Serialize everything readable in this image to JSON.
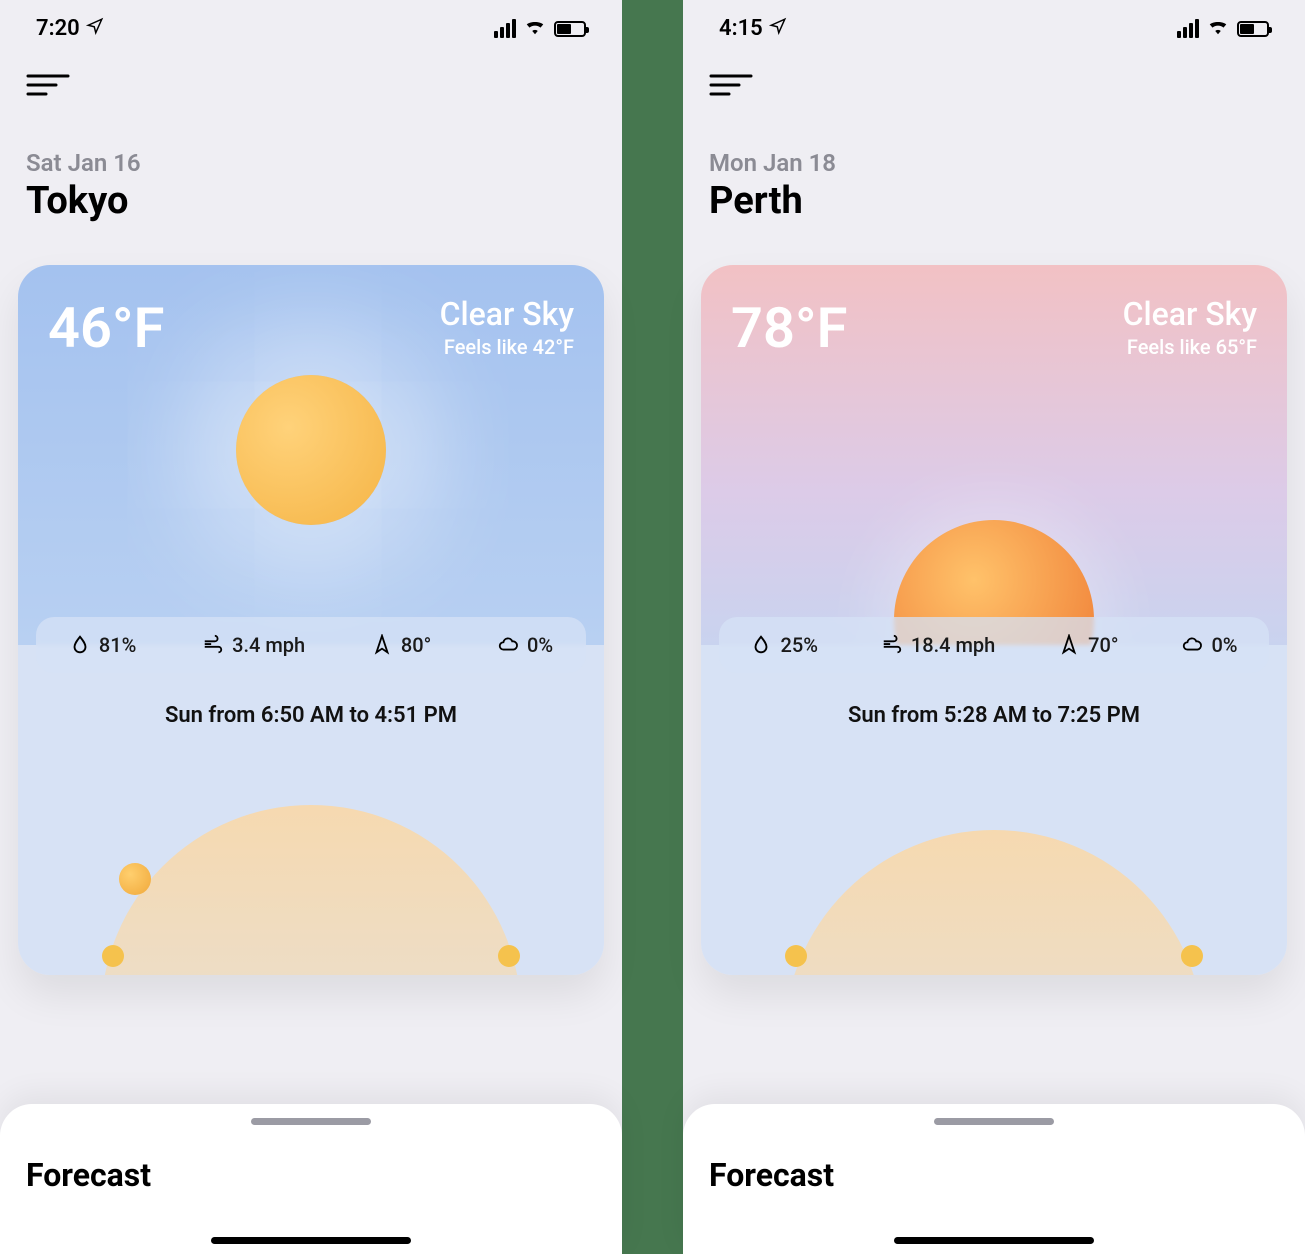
{
  "screens": [
    {
      "status": {
        "time": "7:20"
      },
      "header": {
        "date": "Sat Jan 16",
        "city": "Tokyo"
      },
      "weather": {
        "temp": "46°F",
        "condition": "Clear Sky",
        "feels_like": "Feels like 42°F",
        "stats": {
          "humidity": "81%",
          "wind": "3.4 mph",
          "direction": "80°",
          "cloud": "0%"
        },
        "sun_times": "Sun from 6:50 AM to 4:51 PM"
      },
      "forecast": {
        "title": "Forecast"
      }
    },
    {
      "status": {
        "time": "4:15"
      },
      "header": {
        "date": "Mon Jan 18",
        "city": "Perth"
      },
      "weather": {
        "temp": "78°F",
        "condition": "Clear Sky",
        "feels_like": "Feels like 65°F",
        "stats": {
          "humidity": "25%",
          "wind": "18.4 mph",
          "direction": "70°",
          "cloud": "0%"
        },
        "sun_times": "Sun from 5:28 AM to 7:25 PM"
      },
      "forecast": {
        "title": "Forecast"
      }
    }
  ]
}
